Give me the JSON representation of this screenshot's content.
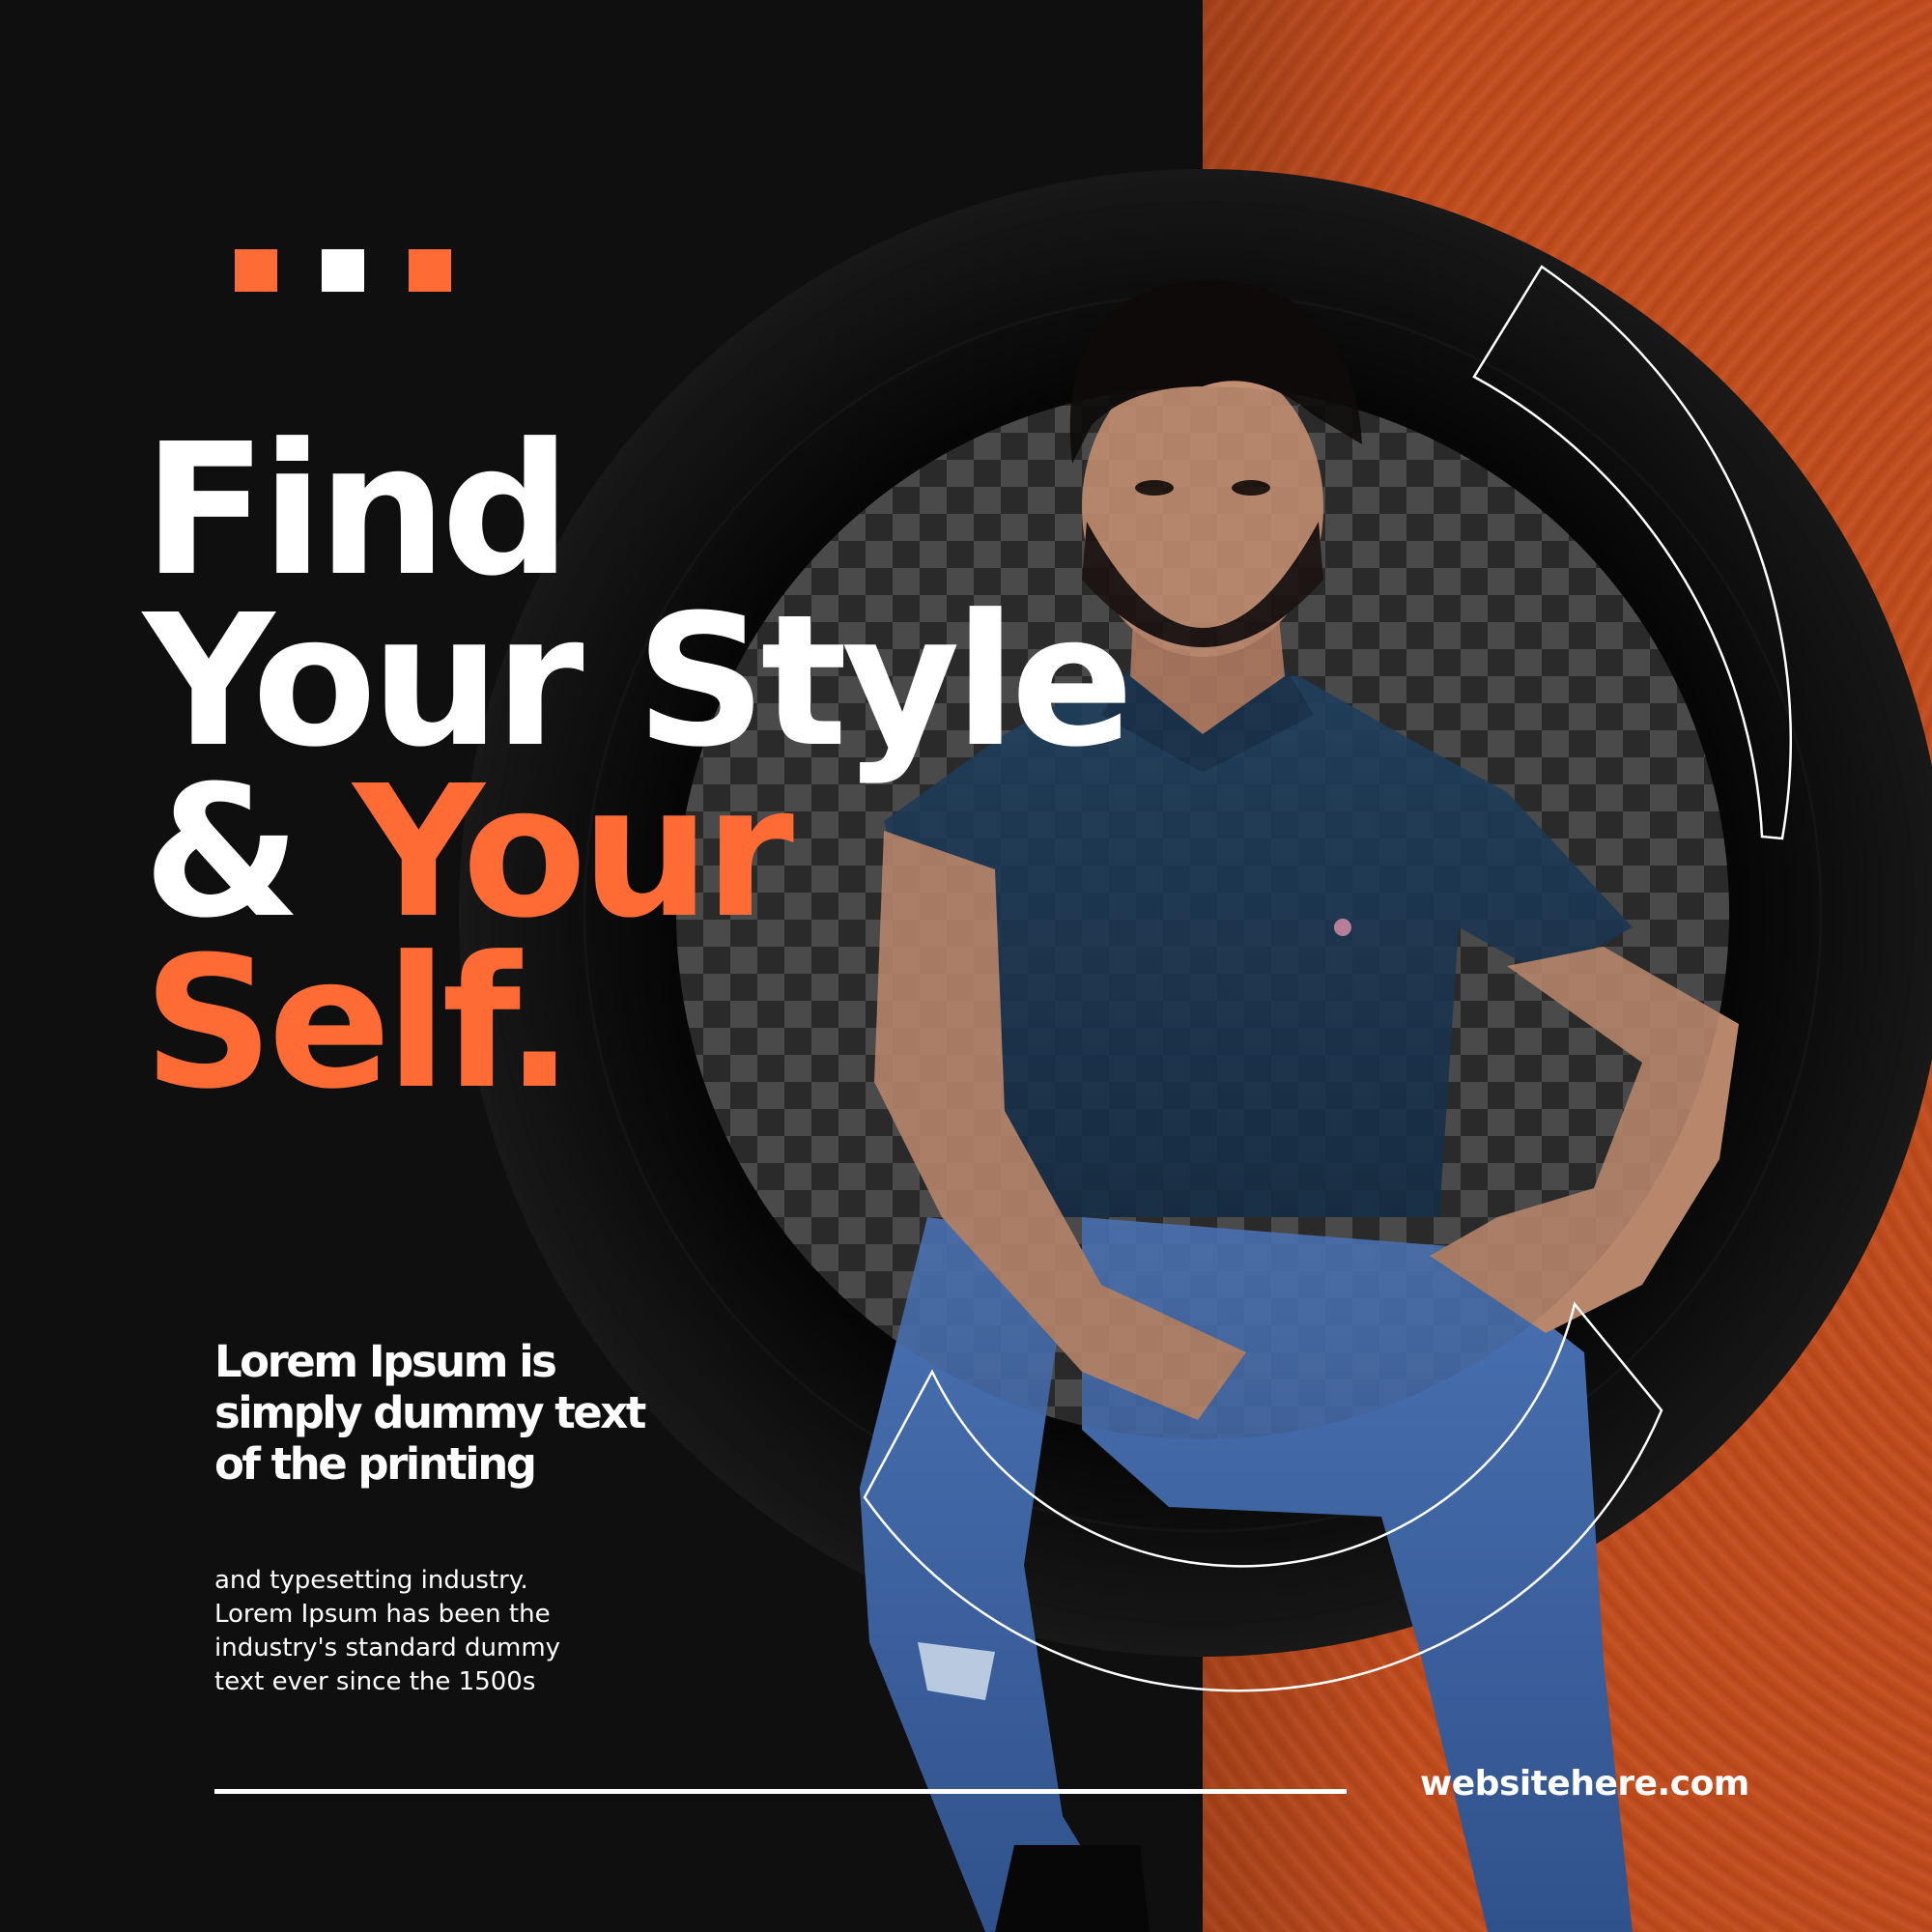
{
  "dots": [
    "#ff6b35",
    "#ffffff",
    "#ff6b35"
  ],
  "headline": {
    "line1": "Find",
    "line2": "Your Style",
    "line3_a": "& ",
    "line3_b": "Your",
    "line4": "Self."
  },
  "subheading": {
    "line1": "Lorem Ipsum is",
    "line2": "simply dummy text",
    "line3": "of the printing"
  },
  "body": {
    "line1": "and typesetting industry.",
    "line2": "Lorem Ipsum has been the",
    "line3": "industry's standard dummy",
    "line4": "text ever since the 1500s"
  },
  "website": "websitehere.com",
  "colors": {
    "background": "#0f0f0f",
    "accent": "#ff6b35",
    "right_panel": "#c4501f",
    "text": "#ffffff"
  }
}
